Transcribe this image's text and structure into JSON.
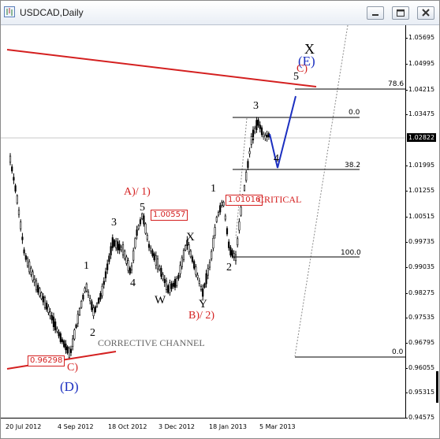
{
  "window": {
    "title": "USDCAD,Daily",
    "controls": [
      "minimize-icon",
      "restore-icon",
      "close-icon"
    ],
    "colors": {
      "bull_line": "#d42020",
      "wave_blue": "#1b2fc0",
      "candles": "#000000"
    }
  },
  "price_axis": {
    "ticks": [
      "1.05695",
      "1.04995",
      "1.04215",
      "1.03475",
      "1.02822",
      "1.01995",
      "1.01255",
      "1.00515",
      "0.99735",
      "0.99035",
      "0.98275",
      "0.97535",
      "0.96795",
      "0.96055",
      "0.95315",
      "0.94575"
    ],
    "tick_values": [
      1.05695,
      1.04995,
      1.04215,
      1.03475,
      1.02822,
      1.01995,
      1.01255,
      1.00515,
      0.99735,
      0.99035,
      0.98275,
      0.97535,
      0.96795,
      0.96055,
      0.95315,
      0.94575
    ],
    "current_price": "1.02822"
  },
  "date_axis": {
    "labels": [
      "20 Jul 2012",
      "4 Sep 2012",
      "18 Oct 2012",
      "3 Dec 2012",
      "18 Jan 2013",
      "5 Mar 2013"
    ]
  },
  "chart_data": {
    "type": "candlestick",
    "symbol": "USDCAD",
    "timeframe": "Daily",
    "ylim": [
      0.944,
      1.062
    ],
    "key_levels": [
      {
        "label": "0.96298",
        "value": 0.96298
      },
      {
        "label": "1.00557",
        "value": 1.00557
      },
      {
        "label": "1.01016",
        "value": 1.01016
      }
    ],
    "fibonacci": [
      {
        "label": "78.6",
        "value": 1.0438
      },
      {
        "label": "0.0",
        "value": 1.0354
      },
      {
        "label": "38.2",
        "value": 1.0177
      },
      {
        "label": "100.0",
        "value": 0.9939
      },
      {
        "label": "0.0",
        "value": 0.9632
      }
    ],
    "annotations": {
      "critical": "CRITICAL",
      "channel": "CORRECTIVE CHANNEL"
    },
    "waves": [
      {
        "text": "X",
        "color": "black"
      },
      {
        "text": "(E)",
        "color": "blue"
      },
      {
        "text": "C)",
        "color": "red"
      },
      {
        "text": "5",
        "color": "black"
      },
      {
        "text": "3",
        "color": "black"
      },
      {
        "text": "4",
        "color": "black"
      },
      {
        "text": "1",
        "color": "black"
      },
      {
        "text": "2",
        "color": "black"
      },
      {
        "text": "A)/ 1)",
        "color": "red"
      },
      {
        "text": "5",
        "color": "black"
      },
      {
        "text": "3",
        "color": "black"
      },
      {
        "text": "4",
        "color": "black"
      },
      {
        "text": "1",
        "color": "black"
      },
      {
        "text": "2",
        "color": "black"
      },
      {
        "text": "X",
        "color": "black"
      },
      {
        "text": "W",
        "color": "black"
      },
      {
        "text": "Y",
        "color": "black"
      },
      {
        "text": "B)/ 2)",
        "color": "red"
      },
      {
        "text": "C)",
        "color": "red"
      },
      {
        "text": "(D)",
        "color": "blue"
      }
    ]
  }
}
